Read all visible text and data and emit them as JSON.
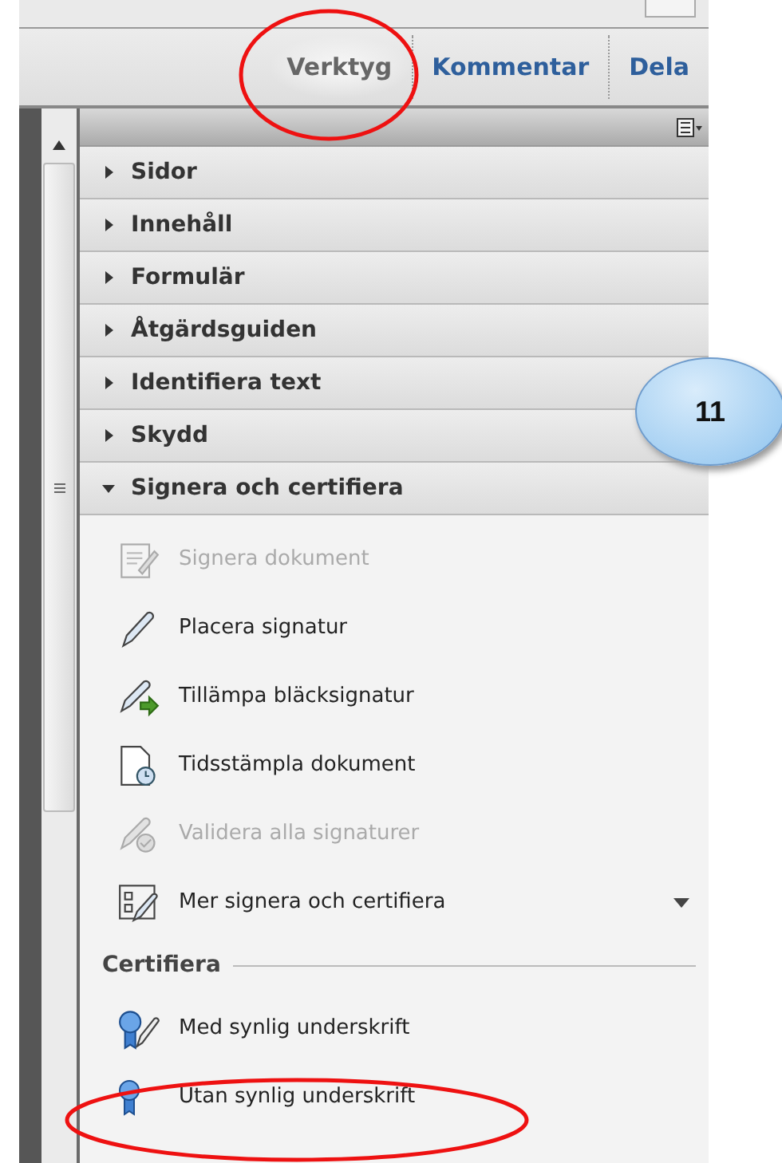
{
  "tabs": [
    {
      "label": "Verktyg",
      "selected": true
    },
    {
      "label": "Kommentar",
      "selected": false
    },
    {
      "label": "Dela",
      "selected": false
    }
  ],
  "sections": [
    {
      "label": "Sidor",
      "expanded": false
    },
    {
      "label": "Innehåll",
      "expanded": false
    },
    {
      "label": "Formulär",
      "expanded": false
    },
    {
      "label": "Åtgärdsguiden",
      "expanded": false
    },
    {
      "label": "Identifiera text",
      "expanded": false
    },
    {
      "label": "Skydd",
      "expanded": false
    },
    {
      "label": "Signera och certifiera",
      "expanded": true
    }
  ],
  "items": [
    {
      "label": "Signera dokument",
      "disabled": true,
      "submenu": false
    },
    {
      "label": "Placera signatur",
      "disabled": false,
      "submenu": false
    },
    {
      "label": "Tillämpa bläcksignatur",
      "disabled": false,
      "submenu": false
    },
    {
      "label": "Tidsstämpla dokument",
      "disabled": false,
      "submenu": false
    },
    {
      "label": "Validera alla signaturer",
      "disabled": true,
      "submenu": false
    },
    {
      "label": "Mer signera och certifiera",
      "disabled": false,
      "submenu": true
    }
  ],
  "certify": {
    "heading": "Certifiera",
    "items": [
      {
        "label": "Med synlig underskrift",
        "disabled": false
      },
      {
        "label": "Utan synlig underskrift",
        "disabled": false
      }
    ]
  },
  "callout": "11"
}
